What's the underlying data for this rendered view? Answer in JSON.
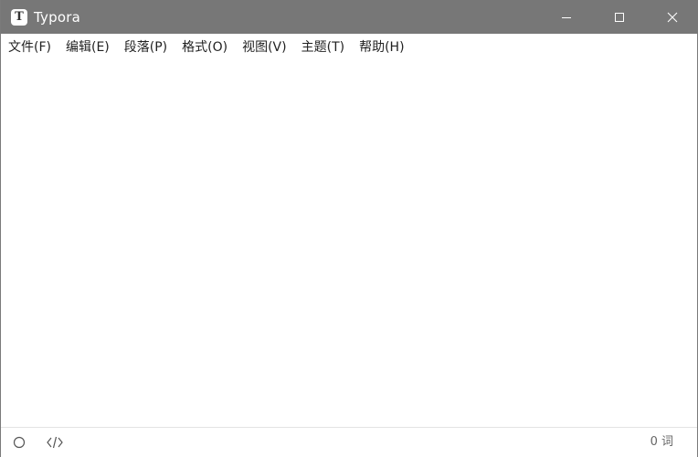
{
  "window": {
    "title": "Typora",
    "app_icon_letter": "T",
    "titlebar_color": "#777777"
  },
  "menubar": {
    "items": [
      {
        "label": "文件(F)"
      },
      {
        "label": "编辑(E)"
      },
      {
        "label": "段落(P)"
      },
      {
        "label": "格式(O)"
      },
      {
        "label": "视图(V)"
      },
      {
        "label": "主题(T)"
      },
      {
        "label": "帮助(H)"
      }
    ]
  },
  "statusbar": {
    "outline_toggle_icon": "circle-icon",
    "source_mode_icon": "code-brackets-icon",
    "word_count": "0 词"
  }
}
